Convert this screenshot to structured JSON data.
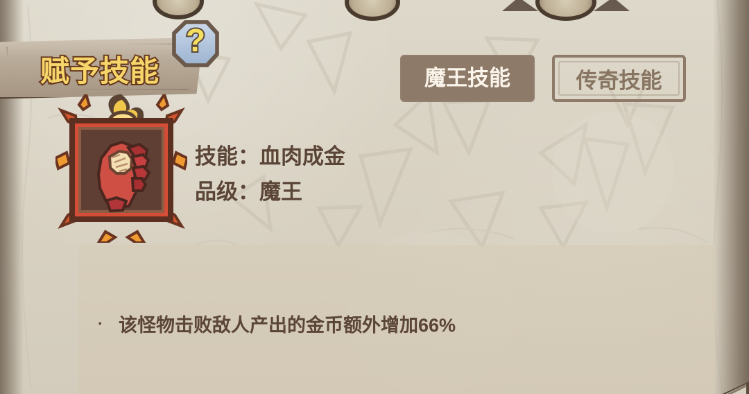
{
  "screen": {
    "title": "赋予技能",
    "help_symbol": "?"
  },
  "tabs": [
    {
      "label": "魔王技能",
      "active": true
    },
    {
      "label": "传奇技能",
      "active": false
    }
  ],
  "skill_info": {
    "skill_label": "技能：",
    "skill_name": "血肉成金",
    "rank_label": "品级：",
    "rank_value": "魔王"
  },
  "description": {
    "bullet": "·",
    "text": "该怪物击败敌人产出的金币额外增加66%"
  },
  "icons": {
    "help": "question-mark-icon",
    "skill": "flesh-to-gold-hand-icon",
    "flame_crest": "flame-crest-icon"
  },
  "colors": {
    "background": "#d7d0bf",
    "title_gold": "#f6d66a",
    "active_tab": "#8d7a68",
    "text_brown": "#5a4537",
    "help_blue": "#9db4d1"
  }
}
